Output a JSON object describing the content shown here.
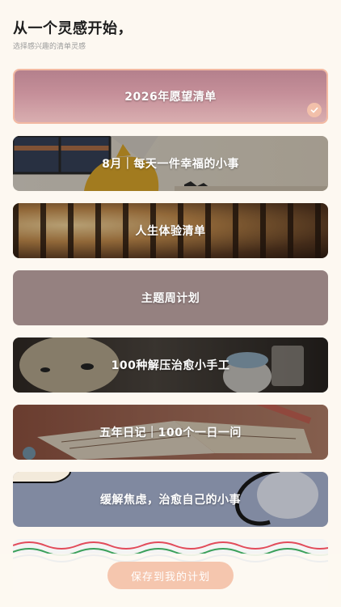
{
  "header": {
    "title": "从一个灵感开始，",
    "subtitle": "选择感兴趣的清单灵感"
  },
  "cards": [
    {
      "label": "2026年愿望清单",
      "selected": true
    },
    {
      "label": "8月｜每天一件幸福的小事",
      "selected": false
    },
    {
      "label": "人生体验清单",
      "selected": false
    },
    {
      "label": "主题周计划",
      "selected": false
    },
    {
      "label": "100种解压治愈小手工",
      "selected": false
    },
    {
      "label": "五年日记｜100个一日一问",
      "selected": false
    },
    {
      "label": "缓解焦虑，治愈自己的小事",
      "selected": false
    }
  ],
  "footer": {
    "save_label": "保存到我的计划"
  },
  "colors": {
    "accent": "#f5c6ae",
    "background": "#fdf8f1"
  }
}
